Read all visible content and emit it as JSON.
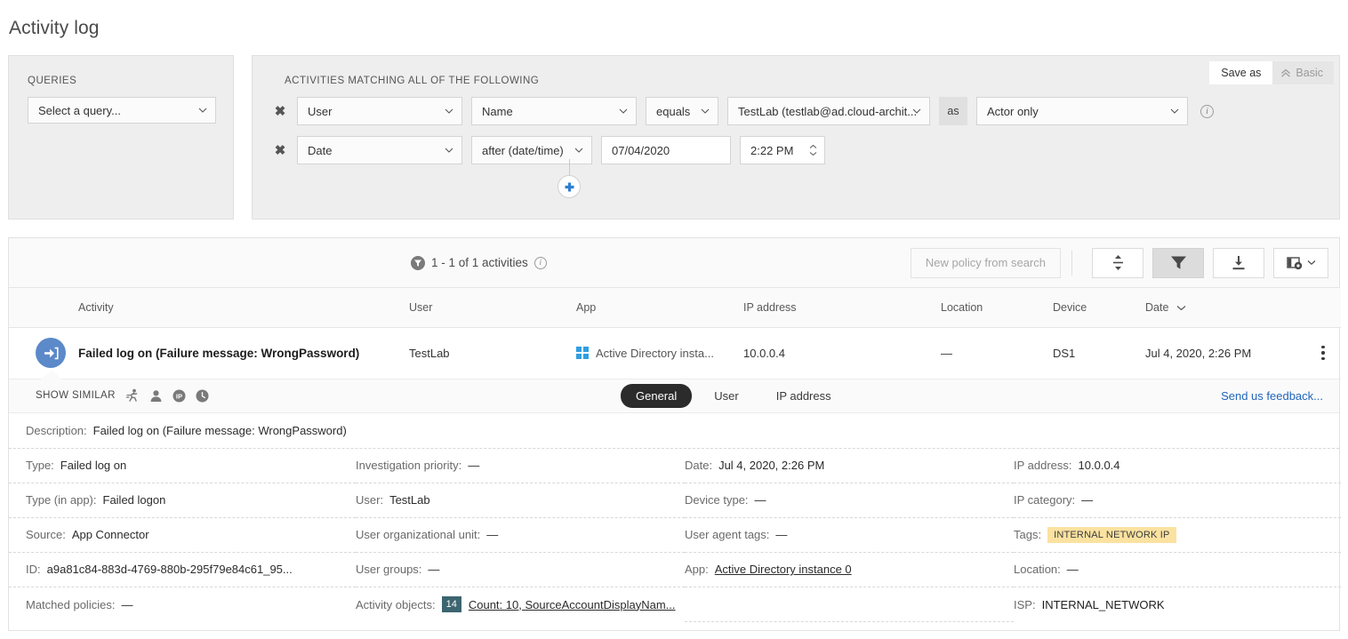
{
  "page": {
    "title": "Activity log"
  },
  "queries_panel": {
    "caption": "QUERIES",
    "select_value": "Select a query...",
    "chevron_icon": "chevron-down-icon"
  },
  "filters_panel": {
    "caption": "ACTIVITIES MATCHING ALL OF THE FOLLOWING",
    "save_as_label": "Save as",
    "basic_label": "Basic",
    "basic_icon": "chevron-double-up-icon",
    "info_icon": "info-circle-icon",
    "add_condition_icon": "plus-icon",
    "remove_icon": "close-x-icon",
    "rows": [
      {
        "field": "User",
        "subfield": "Name",
        "operator": "equals",
        "value": "TestLab (testlab@ad.cloud-archit...",
        "as_label": "as",
        "scope": "Actor only"
      },
      {
        "field": "Date",
        "operator": "after (date/time)",
        "date_value": "07/04/2020",
        "time_value": "2:22 PM",
        "spinner_icon": "stepper-up-down-icon"
      }
    ]
  },
  "results_toolbar": {
    "filter_badge_icon": "filter-funnel-badge-icon",
    "count_text": "1 - 1 of 1 activities",
    "info_icon": "info-circle-icon",
    "new_policy_label": "New policy from search",
    "buttons": [
      {
        "name": "expand-rows-button",
        "icon": "expand-collapse-icon",
        "active": false
      },
      {
        "name": "filter-button",
        "icon": "filter-funnel-icon",
        "active": true
      },
      {
        "name": "export-button",
        "icon": "download-icon",
        "active": false
      },
      {
        "name": "column-settings-button",
        "icon": "table-settings-icon",
        "active": false
      }
    ]
  },
  "table": {
    "columns": [
      "Activity",
      "User",
      "App",
      "IP address",
      "Location",
      "Device",
      "Date"
    ],
    "sorted_column": "Date",
    "sort_icon": "chevron-down-icon",
    "rows": [
      {
        "icon": "sign-in-arrow-icon",
        "activity": "Failed log on (Failure message: WrongPassword)",
        "user": "TestLab",
        "app_icon": "windows-logo-icon",
        "app": "Active Directory insta...",
        "ip": "10.0.0.4",
        "location": "—",
        "device": "DS1",
        "date": "Jul 4, 2020, 2:26 PM",
        "menu_icon": "more-vertical-icon"
      }
    ]
  },
  "similar_bar": {
    "label": "SHOW SIMILAR",
    "icons": [
      {
        "name": "running-person-icon"
      },
      {
        "name": "user-person-icon"
      },
      {
        "name": "ip-circle-icon"
      },
      {
        "name": "clock-icon"
      }
    ],
    "tabs": [
      {
        "label": "General",
        "active": true
      },
      {
        "label": "User",
        "active": false
      },
      {
        "label": "IP address",
        "active": false
      }
    ],
    "feedback_link": "Send us feedback..."
  },
  "details": {
    "description": {
      "label": "Description:",
      "value": "Failed log on (Failure message: WrongPassword)"
    },
    "col1": [
      {
        "label": "Type:",
        "value": "Failed log on"
      },
      {
        "label": "Type (in app):",
        "value": "Failed logon"
      },
      {
        "label": "Source:",
        "value": "App Connector"
      },
      {
        "label": "ID:",
        "value": "a9a81c84-883d-4769-880b-295f79e84c61_95..."
      },
      {
        "label": "Matched policies:",
        "value": "—"
      }
    ],
    "col2": [
      {
        "label": "Investigation priority:",
        "value": "—"
      },
      {
        "label": "User:",
        "value": "TestLab"
      },
      {
        "label": "User organizational unit:",
        "value": "—"
      },
      {
        "label": "User groups:",
        "value": "—"
      },
      {
        "label": "Activity objects:",
        "badge": "14",
        "link": "Count: 10, SourceAccountDisplayNam..."
      }
    ],
    "col3": [
      {
        "label": "Date:",
        "value": "Jul 4, 2020, 2:26 PM"
      },
      {
        "label": "Device type:",
        "value": "—"
      },
      {
        "label": "User agent tags:",
        "value": "—"
      },
      {
        "label": "App:",
        "link": "Active Directory instance 0"
      }
    ],
    "col4": [
      {
        "label": "IP address:",
        "value": "10.0.0.4"
      },
      {
        "label": "IP category:",
        "value": "—"
      },
      {
        "label": "Tags:",
        "tag": "INTERNAL NETWORK IP"
      },
      {
        "label": "Location:",
        "value": "—"
      },
      {
        "label": "ISP:",
        "value": "INTERNAL_NETWORK"
      }
    ]
  },
  "colors": {
    "accent_blue": "#5b89c9",
    "link_blue": "#2266bb",
    "badge_teal": "#3c6570",
    "tag_yellow": "#fbe2a0",
    "panel_gray": "#eeeeee"
  }
}
